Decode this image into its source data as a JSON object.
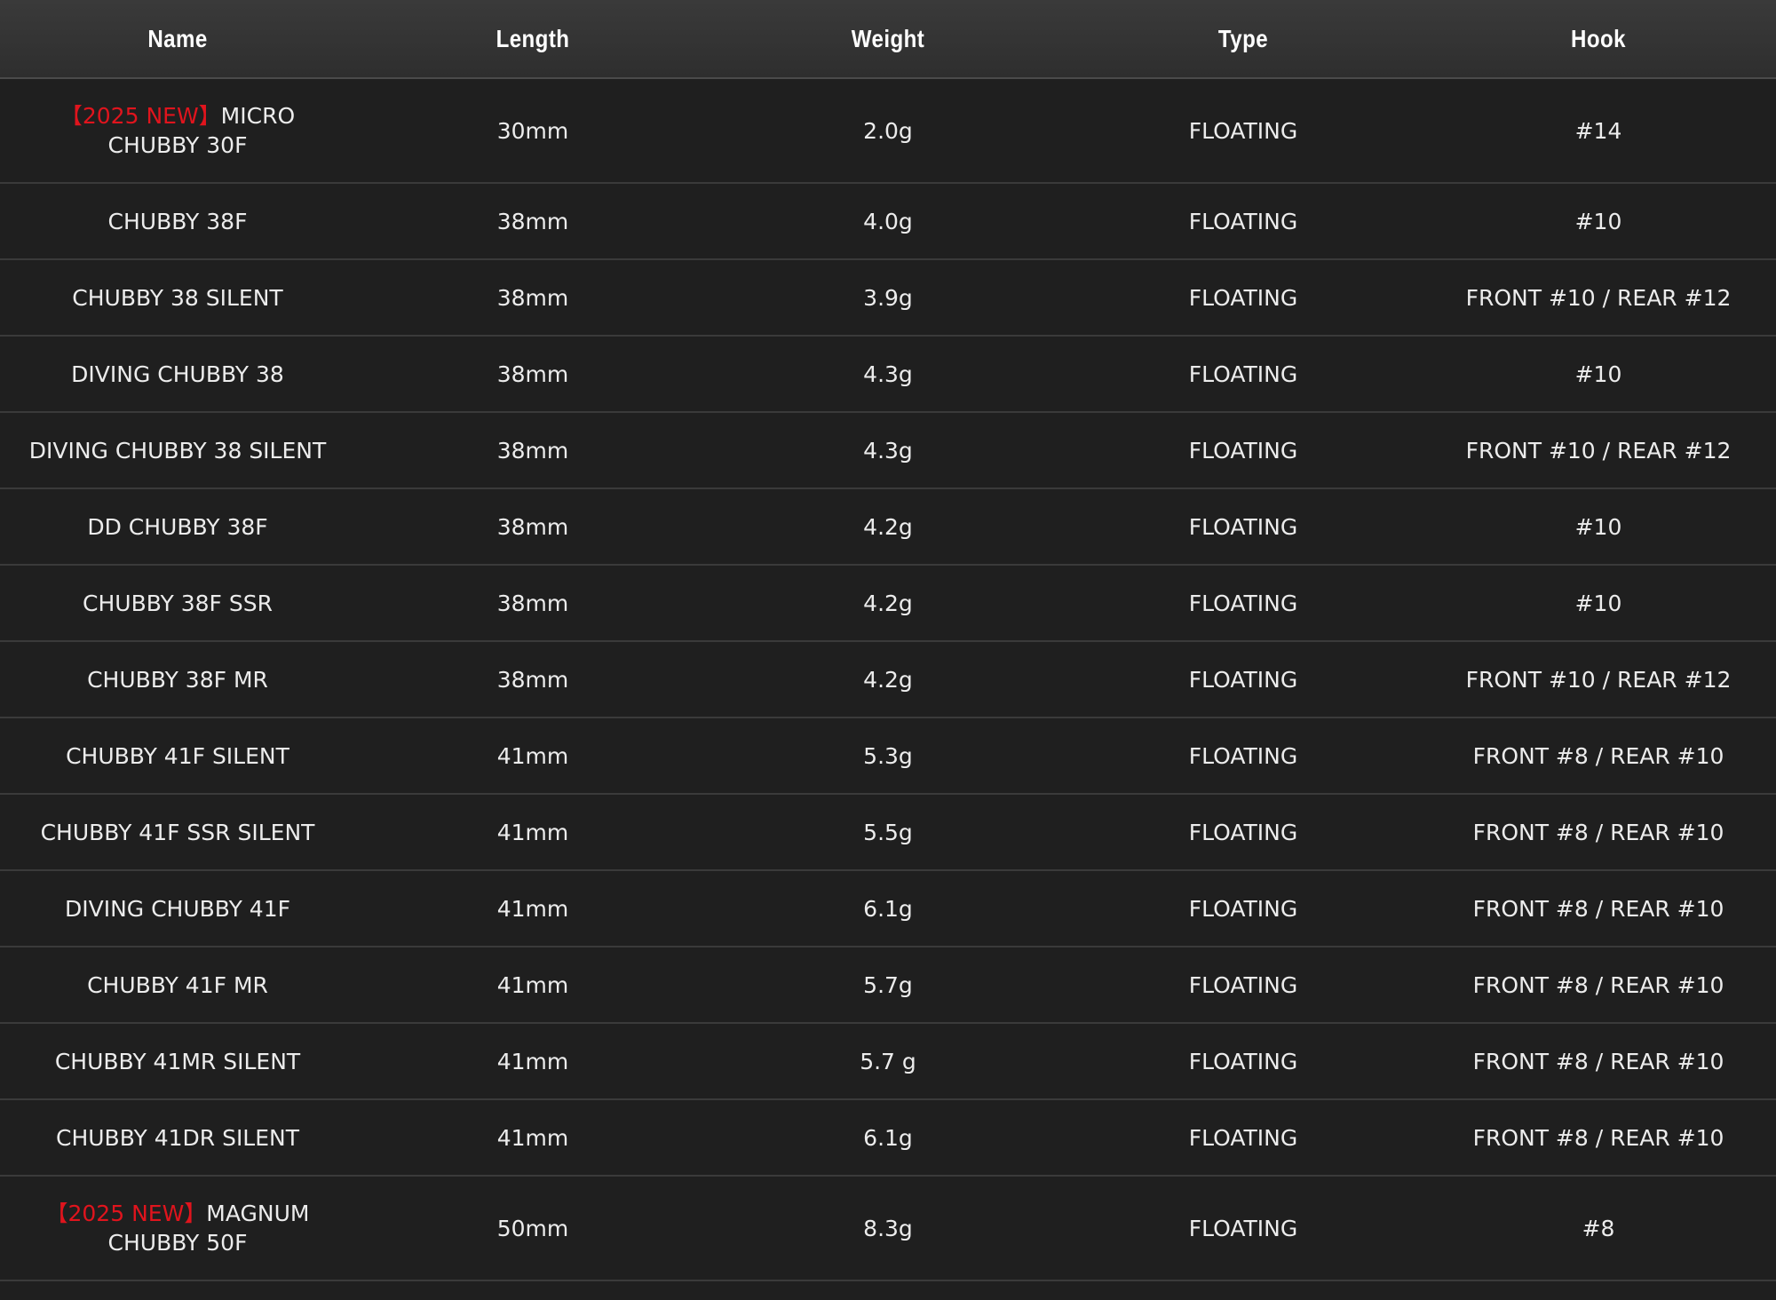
{
  "table": {
    "headers": {
      "name": "Name",
      "length": "Length",
      "weight": "Weight",
      "type": "Type",
      "hook": "Hook"
    },
    "accent_new_color": "#e0141d",
    "rows": [
      {
        "new_tag": "【2025 NEW】",
        "name_line1": "MICRO",
        "name_line2": "CHUBBY 30F",
        "length": "30mm",
        "weight": "2.0g",
        "type": "FLOATING",
        "hook": "#14"
      },
      {
        "name": "CHUBBY 38F",
        "length": "38mm",
        "weight": "4.0g",
        "type": "FLOATING",
        "hook": "#10"
      },
      {
        "name": "CHUBBY 38 SILENT",
        "length": "38mm",
        "weight": "3.9g",
        "type": "FLOATING",
        "hook": "FRONT #10 / REAR #12"
      },
      {
        "name": "DIVING CHUBBY 38",
        "length": "38mm",
        "weight": "4.3g",
        "type": "FLOATING",
        "hook": "#10"
      },
      {
        "name": "DIVING CHUBBY 38 SILENT",
        "length": "38mm",
        "weight": "4.3g",
        "type": "FLOATING",
        "hook": "FRONT #10 / REAR #12"
      },
      {
        "name": "DD CHUBBY 38F",
        "length": "38mm",
        "weight": "4.2g",
        "type": "FLOATING",
        "hook": "#10"
      },
      {
        "name": "CHUBBY 38F SSR",
        "length": "38mm",
        "weight": "4.2g",
        "type": "FLOATING",
        "hook": "#10"
      },
      {
        "name": "CHUBBY 38F MR",
        "length": "38mm",
        "weight": "4.2g",
        "type": "FLOATING",
        "hook": "FRONT #10 / REAR #12"
      },
      {
        "name": "CHUBBY 41F SILENT",
        "length": "41mm",
        "weight": "5.3g",
        "type": "FLOATING",
        "hook": "FRONT #8 / REAR #10"
      },
      {
        "name": "CHUBBY 41F SSR SILENT",
        "length": "41mm",
        "weight": "5.5g",
        "type": "FLOATING",
        "hook": "FRONT #8 / REAR #10"
      },
      {
        "name": "DIVING CHUBBY 41F",
        "length": "41mm",
        "weight": "6.1g",
        "type": "FLOATING",
        "hook": "FRONT #8 / REAR #10"
      },
      {
        "name": "CHUBBY 41F MR",
        "length": "41mm",
        "weight": "5.7g",
        "type": "FLOATING",
        "hook": "FRONT #8 / REAR #10"
      },
      {
        "name": "CHUBBY 41MR SILENT",
        "length": "41mm",
        "weight": "5.7 g",
        "type": "FLOATING",
        "hook": "FRONT #8 / REAR #10"
      },
      {
        "name": "CHUBBY 41DR SILENT",
        "length": "41mm",
        "weight": "6.1g",
        "type": "FLOATING",
        "hook": "FRONT #8 / REAR #10"
      },
      {
        "new_tag": "【2025 NEW】",
        "name_line1": "MAGNUM",
        "name_line2": "CHUBBY 50F",
        "length": "50mm",
        "weight": "8.3g",
        "type": "FLOATING",
        "hook": "#8"
      }
    ]
  }
}
